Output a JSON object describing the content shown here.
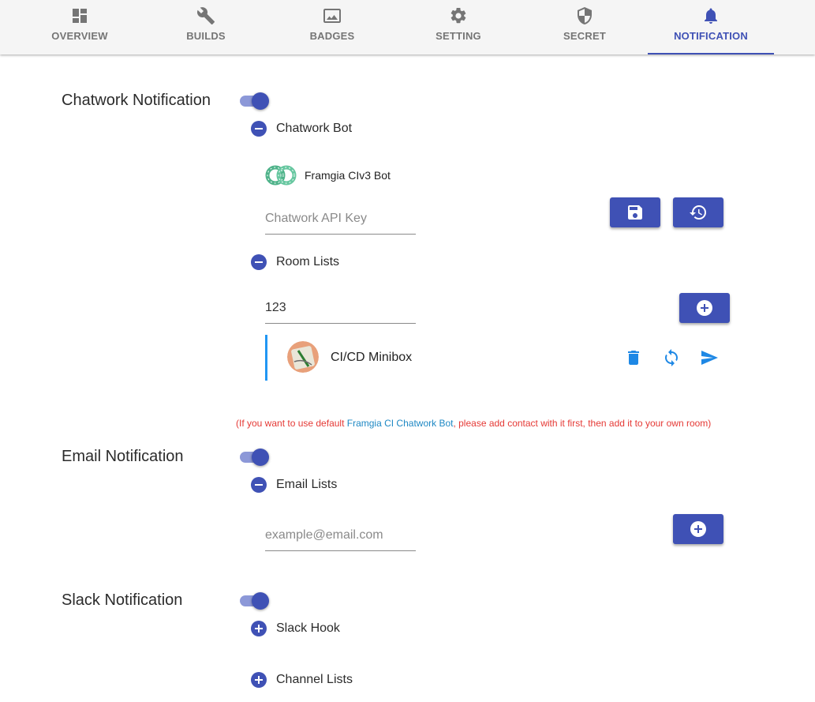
{
  "tabs": [
    {
      "label": "OVERVIEW",
      "icon": "dashboard-icon"
    },
    {
      "label": "BUILDS",
      "icon": "wrench-icon"
    },
    {
      "label": "BADGES",
      "icon": "image-icon"
    },
    {
      "label": "SETTING",
      "icon": "gear-icon"
    },
    {
      "label": "SECRET",
      "icon": "shield-icon"
    },
    {
      "label": "NOTIFICATION",
      "icon": "bell-icon",
      "active": true
    }
  ],
  "colors": {
    "primary": "#3f51b5",
    "accent_blue": "#2196f3",
    "warning_red": "#e53935"
  },
  "chatwork": {
    "title": "Chatwork Notification",
    "enabled": true,
    "bot_section": "Chatwork Bot",
    "bot_name": "Framgia CIv3 Bot",
    "api_key_placeholder": "Chatwork API Key",
    "room_section": "Room Lists",
    "room_input_value": "123",
    "rooms": [
      {
        "name": "CI/CD Minibox"
      }
    ],
    "notice_prefix": "(If you want to use default ",
    "notice_link": "Framgia CI Chatwork Bot",
    "notice_suffix": ", please add contact with it first, then add it to your own room)"
  },
  "email": {
    "title": "Email Notification",
    "enabled": true,
    "list_section": "Email Lists",
    "input_placeholder": "example@email.com"
  },
  "slack": {
    "title": "Slack Notification",
    "enabled": true,
    "hook_section": "Slack Hook",
    "channel_section": "Channel Lists"
  }
}
